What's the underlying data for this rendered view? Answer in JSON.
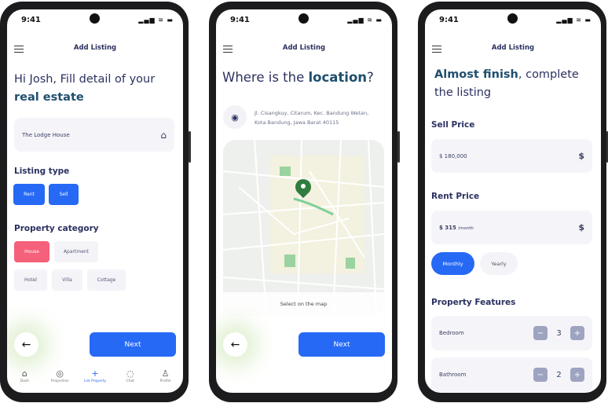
{
  "status": {
    "time": "9:41",
    "icons": "signal-wifi-battery"
  },
  "header": {
    "title": "Add Listing"
  },
  "colors": {
    "primary": "#2669f5",
    "selected_category": "#f5607a",
    "heading": "#2b3160",
    "accent": "#1f4e6e"
  },
  "screen1": {
    "title_line1": "Hi Josh, Fill detail of your",
    "title_bold": "real estate",
    "name_value": "The Lodge House",
    "listing_type_label": "Listing type",
    "listing_types": [
      "Rent",
      "Sell"
    ],
    "category_label": "Property category",
    "categories": [
      "House",
      "Apartment",
      "Hotel",
      "Villa",
      "Cottage"
    ],
    "selected_category": "House",
    "next": "Next",
    "nav": [
      "Dash",
      "Properties",
      "List Property",
      "Chat",
      "Profile"
    ],
    "nav_active": "List Property"
  },
  "screen2": {
    "title_pre": "Where is the ",
    "title_bold": "location",
    "title_post": "?",
    "address_line1": "Jl. Cisangkuy, Citarum, Kec. Bandung Wetan,",
    "address_line2": "Kota Bandung, Jawa Barat 40115",
    "map_hint": "Select on the map",
    "next": "Next"
  },
  "screen3": {
    "title_bold": "Almost finish",
    "title_rest": ", complete",
    "title_line2": "the listing",
    "sell_label": "Sell Price",
    "sell_value": "$ 180,000",
    "currency": "$",
    "rent_label": "Rent Price",
    "rent_value": "$ 315",
    "rent_unit": "/month",
    "periods": [
      "Monthly",
      "Yearly"
    ],
    "selected_period": "Monthly",
    "features_label": "Property Features",
    "features": [
      {
        "name": "Bedroom",
        "count": "3"
      },
      {
        "name": "Bathroom",
        "count": "2"
      }
    ],
    "minus": "−",
    "plus": "+"
  }
}
